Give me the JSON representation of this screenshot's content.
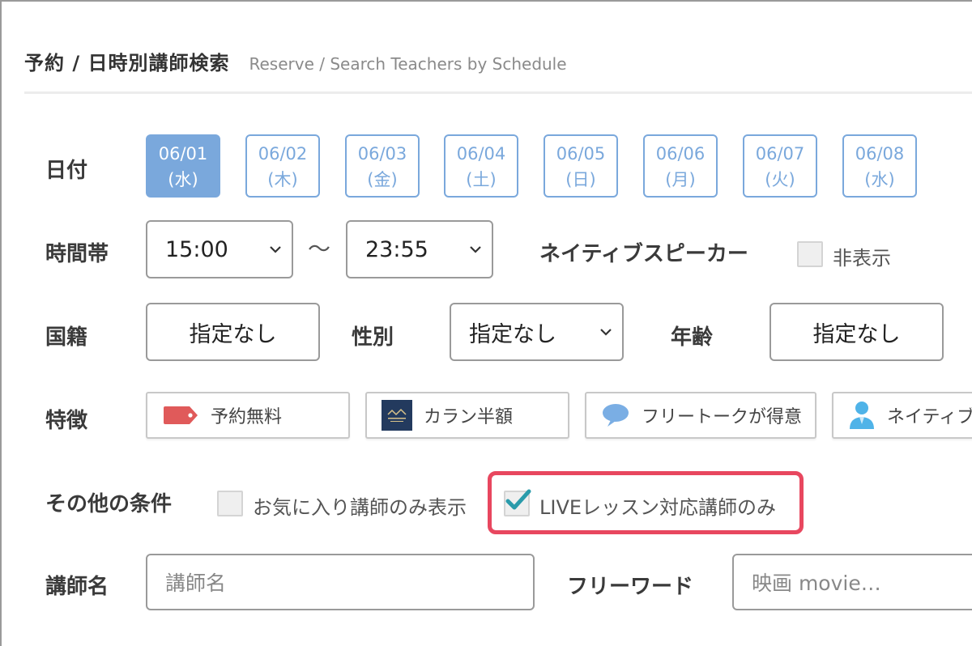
{
  "header": {
    "title_ja": "予約 / 日時別講師検索",
    "title_en": "Reserve / Search Teachers by Schedule"
  },
  "date": {
    "label": "日付",
    "items": [
      {
        "date": "06/01",
        "day": "(水)",
        "selected": true
      },
      {
        "date": "06/02",
        "day": "(木)",
        "selected": false
      },
      {
        "date": "06/03",
        "day": "(金)",
        "selected": false
      },
      {
        "date": "06/04",
        "day": "(土)",
        "selected": false
      },
      {
        "date": "06/05",
        "day": "(日)",
        "selected": false
      },
      {
        "date": "06/06",
        "day": "(月)",
        "selected": false
      },
      {
        "date": "06/07",
        "day": "(火)",
        "selected": false
      },
      {
        "date": "06/08",
        "day": "(水)",
        "selected": false
      }
    ]
  },
  "time": {
    "label": "時間帯",
    "from": "15:00",
    "separator": "〜",
    "to": "23:55"
  },
  "native": {
    "label": "ネイティブスピーカー",
    "hide_label": "非表示",
    "checked": false
  },
  "nationality": {
    "label": "国籍",
    "value": "指定なし"
  },
  "gender": {
    "label": "性別",
    "value": "指定なし"
  },
  "age": {
    "label": "年齢",
    "value": "指定なし"
  },
  "features": {
    "label": "特徴",
    "items": [
      {
        "label": "予約無料",
        "icon": "red-tag-icon"
      },
      {
        "label": "カラン半額",
        "icon": "callan-logo-icon"
      },
      {
        "label": "フリートークが得意",
        "icon": "speech-bubble-icon"
      },
      {
        "label": "ネイティブ",
        "icon": "person-icon"
      }
    ]
  },
  "other": {
    "label": "その他の条件",
    "favorites_label": "お気に入り講師のみ表示",
    "favorites_checked": false,
    "live_label": "LIVEレッスン対応講師のみ",
    "live_checked": true
  },
  "teacher_name": {
    "label": "講師名",
    "placeholder": "講師名"
  },
  "freeword": {
    "label": "フリーワード",
    "placeholder": "映画 movie…"
  },
  "colors": {
    "accent_blue": "#7aa8dc",
    "highlight_red": "#e8475f",
    "check_teal": "#2a9bab"
  }
}
